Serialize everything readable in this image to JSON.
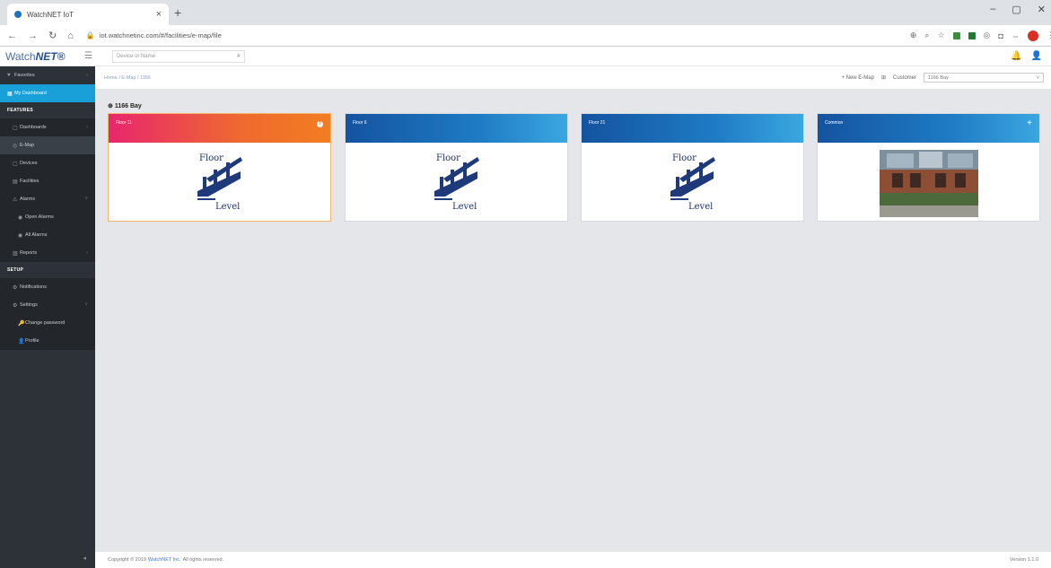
{
  "browser": {
    "tab_title": "WatchNET IoT",
    "tab_close": "×",
    "new_tab": "+",
    "url": "iot.watchnetinc.com/#/facilities/e-map/file",
    "win_min": "–",
    "win_max": "▢",
    "win_close": "✕"
  },
  "header": {
    "logo_watch": "Watch",
    "logo_net": "NET®",
    "search_placeholder": "Device or Name"
  },
  "sidebar": {
    "items": [
      {
        "icon": "♥",
        "label": "Favorites"
      },
      {
        "icon": "▦",
        "label": "My Dashboard"
      }
    ],
    "section_features": "FEATURES",
    "features": [
      {
        "icon": "▢",
        "label": "Dashboards"
      },
      {
        "icon": "◎",
        "label": "E-Map"
      },
      {
        "icon": "▢",
        "label": "Devices"
      },
      {
        "icon": "▤",
        "label": "Facilities"
      },
      {
        "icon": "⚠",
        "label": "Alarms"
      },
      {
        "icon": "◉",
        "label": "Open Alarms"
      },
      {
        "icon": "◉",
        "label": "All Alarms"
      },
      {
        "icon": "▥",
        "label": "Reports"
      }
    ],
    "section_setup": "SETUP",
    "setup": [
      {
        "icon": "⚙",
        "label": "Notifications"
      },
      {
        "icon": "⚙",
        "label": "Settings"
      },
      {
        "icon": "🔑",
        "label": "Change password"
      },
      {
        "icon": "👤",
        "label": "Profile"
      }
    ],
    "collapse": "◂"
  },
  "main": {
    "breadcrumb": "Home / E-Map / 1166",
    "new_map": "+ New E-Map",
    "customer_label": "Customer",
    "customer_value": "1166 Bay",
    "section_title": "1166 Bay",
    "cards": [
      {
        "title": "Floor 11",
        "badge": "!"
      },
      {
        "title": "Floor 6"
      },
      {
        "title": "Floor 21"
      },
      {
        "title": "Common",
        "plus": "+"
      }
    ],
    "floor_word": "Floor",
    "level_word": "Level"
  },
  "footer": {
    "copyright_prefix": "Copyright © 2019",
    "company": "WatchNET Inc.",
    "copyright_suffix": "All rights reserved.",
    "version": "Version 1.1.0"
  }
}
